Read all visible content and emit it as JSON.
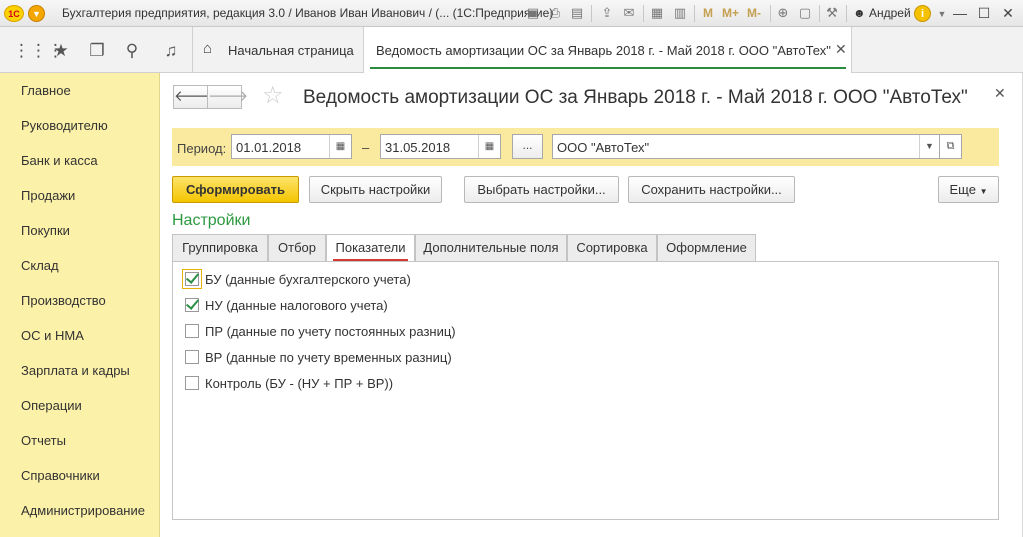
{
  "window": {
    "logo_text": "1С",
    "title": "Бухгалтерия предприятия, редакция 3.0 / Иванов Иван Иванович / (... (1С:Предприятие)",
    "m_label": "M",
    "mplus_label": "M+",
    "mminus_label": "M-",
    "user": "Андрей",
    "info_label": "i"
  },
  "tabs_bar": {
    "home_label": "Начальная страница",
    "report_tab_label": "Ведомость амортизации ОС за Январь 2018 г. - Май 2018 г. ООО \"АвтоТех\""
  },
  "sidebar": {
    "items": [
      "Главное",
      "Руководителю",
      "Банк и касса",
      "Продажи",
      "Покупки",
      "Склад",
      "Производство",
      "ОС и НМА",
      "Зарплата и кадры",
      "Операции",
      "Отчеты",
      "Справочники",
      "Администрирование"
    ]
  },
  "form": {
    "title": "Ведомость амортизации ОС за Январь 2018 г. - Май 2018 г. ООО \"АвтоТех\"",
    "period_label": "Период:",
    "date_from": "01.01.2018",
    "date_dash": "–",
    "date_to": "31.05.2018",
    "dots_label": "...",
    "organization": "ООО \"АвтоТех\""
  },
  "toolbar": {
    "generate": "Сформировать",
    "hide_settings": "Скрыть настройки",
    "choose_settings": "Выбрать настройки...",
    "save_settings": "Сохранить настройки...",
    "more": "Еще"
  },
  "settings": {
    "title": "Настройки",
    "tabs": [
      "Группировка",
      "Отбор",
      "Показатели",
      "Дополнительные поля",
      "Сортировка",
      "Оформление"
    ],
    "active_tab": "Показатели",
    "indicators": [
      {
        "label": "БУ (данные бухгалтерского учета)",
        "checked": true
      },
      {
        "label": "НУ (данные налогового учета)",
        "checked": true
      },
      {
        "label": "ПР (данные по учету постоянных разниц)",
        "checked": false
      },
      {
        "label": "ВР (данные по учету временных разниц)",
        "checked": false
      },
      {
        "label": "Контроль (БУ - (НУ + ПР + ВР))",
        "checked": false
      }
    ]
  },
  "colors": {
    "sidebar_bg": "#fcf1a9",
    "period_bar_bg": "#faeaa0",
    "accent_green": "#2c9940",
    "primary_button": "#f4c500",
    "active_tab_marker": "#d43a33"
  }
}
